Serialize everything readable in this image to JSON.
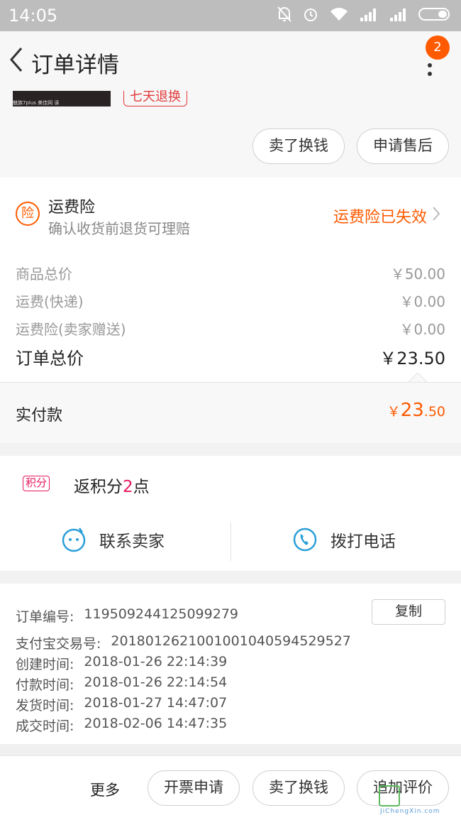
{
  "status": {
    "time": "14:05"
  },
  "header": {
    "title": "订单详情",
    "notification_count": "2"
  },
  "product": {
    "thumb_caption": "魅族7plus 美佳网 读",
    "tag": "七天退换"
  },
  "actions": {
    "sell": "卖了换钱",
    "after_sale": "申请售后"
  },
  "insurance": {
    "icon_char": "险",
    "title": "运费险",
    "subtitle": "确认收货前退货可理赔",
    "status": "运费险已失效"
  },
  "prices": {
    "goods_label": "商品总价",
    "goods_value": "￥50.00",
    "ship_label": "运费(快递)",
    "ship_value": "￥0.00",
    "ins_label": "运费险(卖家赠送)",
    "ins_value": "￥0.00",
    "total_label": "订单总价",
    "total_value": "￥23.50"
  },
  "paid": {
    "label": "实付款",
    "currency": "￥",
    "int": "23",
    "dec": ".50"
  },
  "points": {
    "badge": "积分",
    "prefix": "返积分",
    "num": "2",
    "suffix": "点"
  },
  "contact": {
    "seller": "联系卖家",
    "call": "拨打电话"
  },
  "order_info": {
    "copy_label": "复制",
    "rows": [
      {
        "k": "订单编号:",
        "v": "119509244125099279"
      },
      {
        "k": "支付宝交易号:",
        "v": "2018012621001001040594529527"
      },
      {
        "k": "创建时间:",
        "v": "2018-01-26 22:14:39"
      },
      {
        "k": "付款时间:",
        "v": "2018-01-26 22:14:54"
      },
      {
        "k": "发货时间:",
        "v": "2018-01-27 14:47:07"
      },
      {
        "k": "成交时间:",
        "v": "2018-02-06 14:47:35"
      }
    ]
  },
  "bottom": {
    "more": "更多",
    "invoice": "开票申请",
    "sell": "卖了换钱",
    "review": "追加评价"
  },
  "watermark": {
    "text": "JiChengXin.com"
  },
  "colors": {
    "accent": "#ff5a00",
    "points": "#e8185f",
    "icon_blue": "#2a9fd8"
  }
}
